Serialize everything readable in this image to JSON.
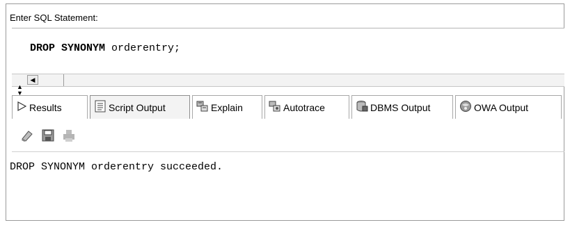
{
  "panel": {
    "header": "Enter SQL Statement:"
  },
  "editor": {
    "keyword": "DROP SYNONYM",
    "rest": " orderentry;"
  },
  "tabs": [
    {
      "label": "Results",
      "icon": "play-arrow-icon",
      "active": false
    },
    {
      "label": "Script Output",
      "icon": "script-document-icon",
      "active": true
    },
    {
      "label": "Explain",
      "icon": "explain-plan-icon",
      "active": false
    },
    {
      "label": "Autotrace",
      "icon": "autotrace-icon",
      "active": false
    },
    {
      "label": "DBMS Output",
      "icon": "dbms-output-icon",
      "active": false
    },
    {
      "label": "OWA Output",
      "icon": "owa-output-icon",
      "active": false
    }
  ],
  "toolbar": {
    "icons": [
      "eraser-icon",
      "save-disk-icon",
      "print-icon"
    ]
  },
  "output": {
    "text": "DROP SYNONYM orderentry succeeded."
  }
}
